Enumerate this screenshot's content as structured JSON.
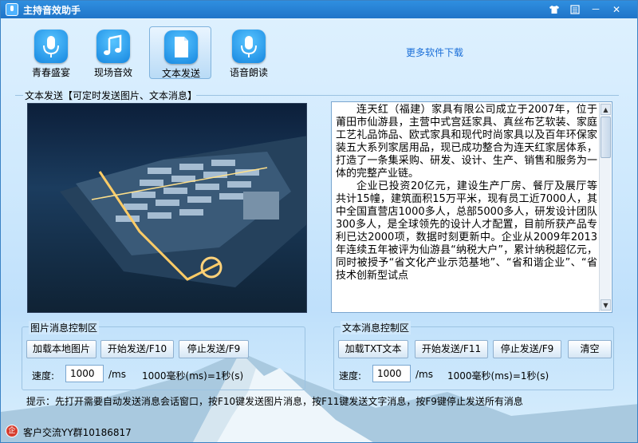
{
  "window": {
    "title": "主持音效助手"
  },
  "titlebar": {
    "skin_icon": "shirt-icon",
    "menu_icon": "menu-icon",
    "minimize": "－",
    "close": "✕"
  },
  "tools": [
    {
      "label": "青春盛宴",
      "icon": "microphone-icon"
    },
    {
      "label": "现场音效",
      "icon": "music-note-icon"
    },
    {
      "label": "文本发送",
      "icon": "document-icon"
    },
    {
      "label": "语音朗读",
      "icon": "microphone-icon"
    }
  ],
  "more_link": "更多软件下载",
  "section_title": "文本发送【可定时发送图片、文本消息】",
  "text_content": {
    "paragraphs": [
      "连天红（福建）家具有限公司成立于2007年，位于莆田市仙游县，主营中式宫廷家具、真丝布艺软装、家庭工艺礼品饰品、欧式家具和现代时尚家具以及百年环保家装五大系列家居用品，现已成功整合为连天红家居体系，打造了一条集采购、研发、设计、生产、销售和服务为一体的完整产业链。",
      "企业已投资20亿元，建设生产厂房、餐厅及展厅等共计15幢，建筑面积15万平米，现有员工近7000人，其中全国直营店1000多人，总部5000多人，研发设计团队300多人，是全球领先的设计人才配置，目前所获产品专利已达2000项，数据时刻更新中。企业从2009年2013年连续五年被评为仙游县“纳税大户”，累计纳税超亿元，同时被授予“省文化产业示范基地”、“省和谐企业”、“省技术创新型试点"
    ]
  },
  "image_group": {
    "title": "图片消息控制区",
    "load_button": "加载本地图片",
    "start_button": "开始发送/F10",
    "stop_button": "停止发送/F9",
    "speed_label": "速度:",
    "speed_value": "1000",
    "unit": "/ms",
    "note": "1000毫秒(ms)=1秒(s)"
  },
  "text_group": {
    "title": "文本消息控制区",
    "load_button": "加载TXT文本",
    "start_button": "开始发送/F11",
    "stop_button": "停止发送/F9",
    "clear_button": "清空",
    "speed_label": "速度:",
    "speed_value": "1000",
    "unit": "/ms",
    "note": "1000毫秒(ms)=1秒(s)"
  },
  "hint": "提示：先打开需要自动发送消息会话窗口，按F10键发送图片消息，按F11键发送文字消息，按F9键停止发送所有消息",
  "status": {
    "text": "客户交流YY群10186817"
  }
}
